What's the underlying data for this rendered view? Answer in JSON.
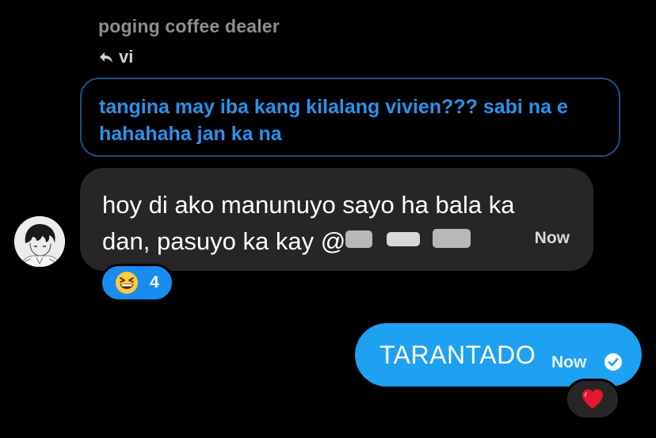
{
  "thread": {
    "sender_name": "poging coffee dealer",
    "reply_target": "vi"
  },
  "quoted_message": {
    "text": "tangina may iba kang kilalang vivien??? sabi na e hahahaha jan ka na"
  },
  "incoming_message": {
    "text_line1": "hoy di ako manunuyo sayo ha bala ka",
    "text_line2": "dan, pasuyo ka kay @",
    "timestamp": "Now",
    "avatar_icon": "avatar-photo",
    "reaction": {
      "emoji_icon": "grinning-squinting-face-icon",
      "count": "4",
      "color": "#1a8cf0"
    }
  },
  "outgoing_message": {
    "text": "TARANTADO",
    "timestamp": "Now",
    "status_icon": "seen-check-icon",
    "bubble_color": "#1ea1f2",
    "reaction": {
      "emoji_icon": "red-heart-icon"
    }
  },
  "colors": {
    "background": "#000000",
    "quote_border": "#1c4f86",
    "quote_text": "#2c92e8",
    "incoming_bubble": "#262626"
  }
}
